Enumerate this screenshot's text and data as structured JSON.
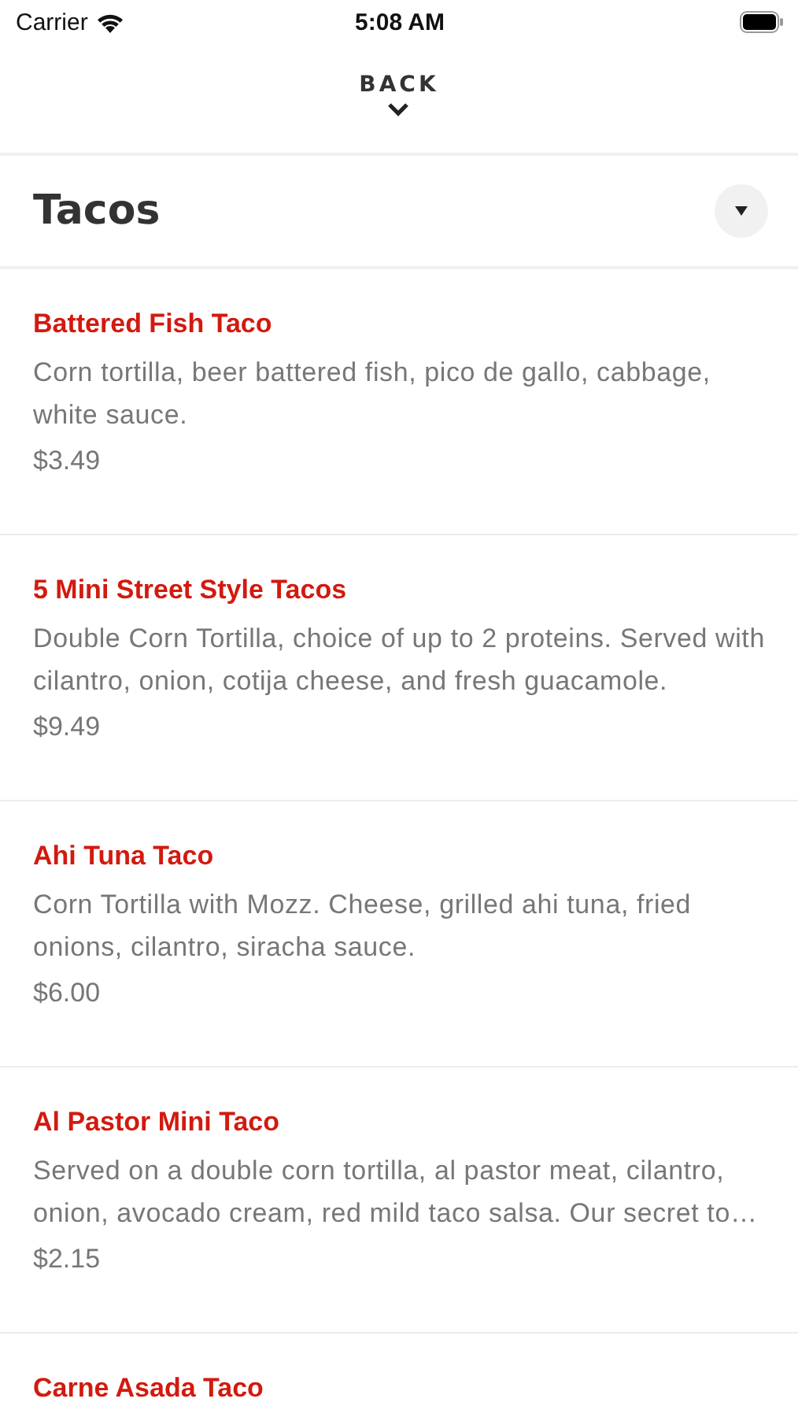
{
  "status_bar": {
    "carrier": "Carrier",
    "time": "5:08 AM"
  },
  "nav": {
    "back_label": "BACK"
  },
  "section": {
    "title": "Tacos",
    "expanded": true
  },
  "items": [
    {
      "name": "Battered Fish Taco",
      "description": "Corn tortilla, beer battered fish, pico de gallo, cabbage, white sauce.",
      "price": "$3.49"
    },
    {
      "name": "5 Mini Street Style Tacos",
      "description": "Double Corn Tortilla, choice of up to 2 proteins. Served with cilantro, onion, cotija cheese, and fresh guacamole.",
      "price": "$9.49"
    },
    {
      "name": "Ahi Tuna Taco",
      "description": "Corn Tortilla with Mozz. Cheese, grilled ahi tuna, fried onions, cilantro, siracha sauce.",
      "price": "$6.00"
    },
    {
      "name": "Al Pastor Mini Taco",
      "description": "Served on a double corn tortilla, al pastor meat, cilantro, onion, avocado cream, red mild taco salsa. Our secret to…",
      "price": "$2.15"
    },
    {
      "name": "Carne Asada Taco"
    }
  ]
}
